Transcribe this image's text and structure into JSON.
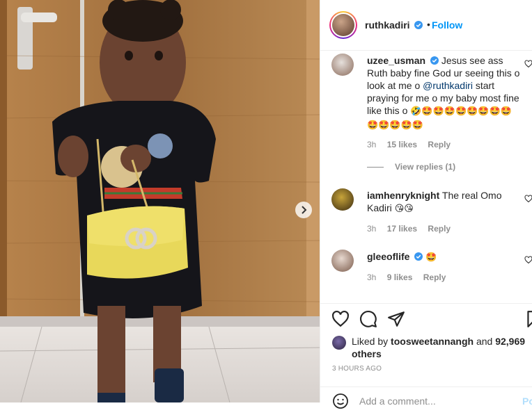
{
  "post": {
    "username": "ruthkadiri",
    "dot": "•",
    "follow_label": "Follow"
  },
  "comments": [
    {
      "username": "uzee_usman",
      "text": "Jesus see ass Ruth baby fine God ur seeing this o look at me o",
      "mention": "@ruthkadiri",
      "text2": "start praying for me o my baby most fine like this o",
      "emojis": "🤣🤩🤩🤩🤩🤩🤩🤩🤩🤩🤩🤩🤩🤩",
      "time": "3h",
      "likes": "15 likes",
      "reply": "Reply",
      "view_replies": "View replies (1)"
    },
    {
      "username": "iamhenryknight",
      "text": "The real Omo Kadiri",
      "emojis": "😘😘",
      "time": "3h",
      "likes": "17 likes",
      "reply": "Reply"
    },
    {
      "username": "gleeoflife",
      "text": "",
      "emojis": "🤩",
      "time": "3h",
      "likes": "9 likes",
      "reply": "Reply"
    }
  ],
  "likes_summary": {
    "prefix": "Liked by",
    "username": "toosweetannangh",
    "and": "and",
    "count": "92,969 others"
  },
  "time_ago": "3 HOURS AGO",
  "add_comment": {
    "placeholder": "Add a comment...",
    "post_label": "Po"
  },
  "colors": {
    "accent": "#0095f6",
    "verified": "#3897f0",
    "muted": "#8e8e8e"
  },
  "icons": [
    "heart-icon",
    "comment-icon",
    "share-icon",
    "bookmark-icon",
    "smile-icon",
    "chevron-right-icon",
    "verified-icon"
  ]
}
